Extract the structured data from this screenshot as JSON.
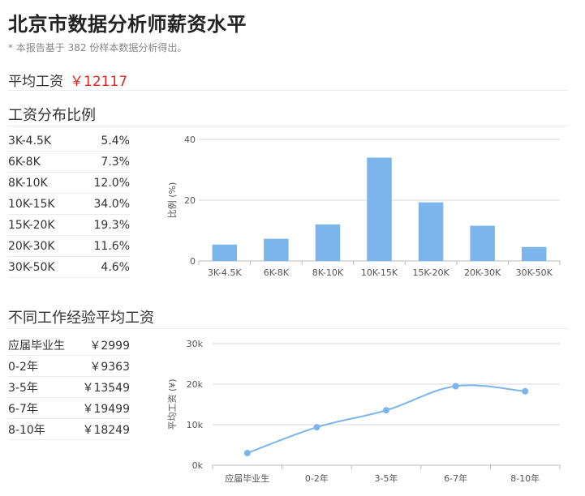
{
  "header": {
    "title": "北京市数据分析师薪资水平",
    "subtitle": "* 本报告基于 382 份样本数据分析得出。",
    "avg_label": "平均工资",
    "avg_value": "￥12117"
  },
  "distribution": {
    "section_title": "工资分布比例",
    "rows": [
      {
        "label": "3K-4.5K",
        "value": "5.4%"
      },
      {
        "label": "6K-8K",
        "value": "7.3%"
      },
      {
        "label": "8K-10K",
        "value": "12.0%"
      },
      {
        "label": "10K-15K",
        "value": "34.0%"
      },
      {
        "label": "15K-20K",
        "value": "19.3%"
      },
      {
        "label": "20K-30K",
        "value": "11.6%"
      },
      {
        "label": "30K-50K",
        "value": "4.6%"
      }
    ]
  },
  "experience": {
    "section_title": "不同工作经验平均工资",
    "rows": [
      {
        "label": "应届毕业生",
        "value": "￥2999"
      },
      {
        "label": "0-2年",
        "value": "￥9363"
      },
      {
        "label": "3-5年",
        "value": "￥13549"
      },
      {
        "label": "6-7年",
        "value": "￥19499"
      },
      {
        "label": "8-10年",
        "value": "￥18249"
      }
    ]
  },
  "colors": {
    "bar": "#7cb5ec",
    "line": "#7cb5ec",
    "grid": "#d9d9d9",
    "accent": "#e3251b"
  },
  "chart_data": [
    {
      "type": "bar",
      "categories": [
        "3K-4.5K",
        "6K-8K",
        "8K-10K",
        "10K-15K",
        "15K-20K",
        "20K-30K",
        "30K-50K"
      ],
      "values": [
        5.4,
        7.3,
        12.0,
        34.0,
        19.3,
        11.6,
        4.6
      ],
      "ylabel": "比例 (%)",
      "yticks": [
        "0",
        "20",
        "40"
      ],
      "ylim": [
        0,
        40
      ],
      "grid": true
    },
    {
      "type": "line",
      "categories": [
        "应届毕业生",
        "0-2年",
        "3-5年",
        "6-7年",
        "8-10年"
      ],
      "values": [
        2999,
        9363,
        13549,
        19499,
        18249
      ],
      "ylabel": "平均工资 (¥)",
      "yticks": [
        "0k",
        "10k",
        "20k",
        "30k"
      ],
      "ylim": [
        0,
        30000
      ],
      "grid": true,
      "smooth": true
    }
  ]
}
